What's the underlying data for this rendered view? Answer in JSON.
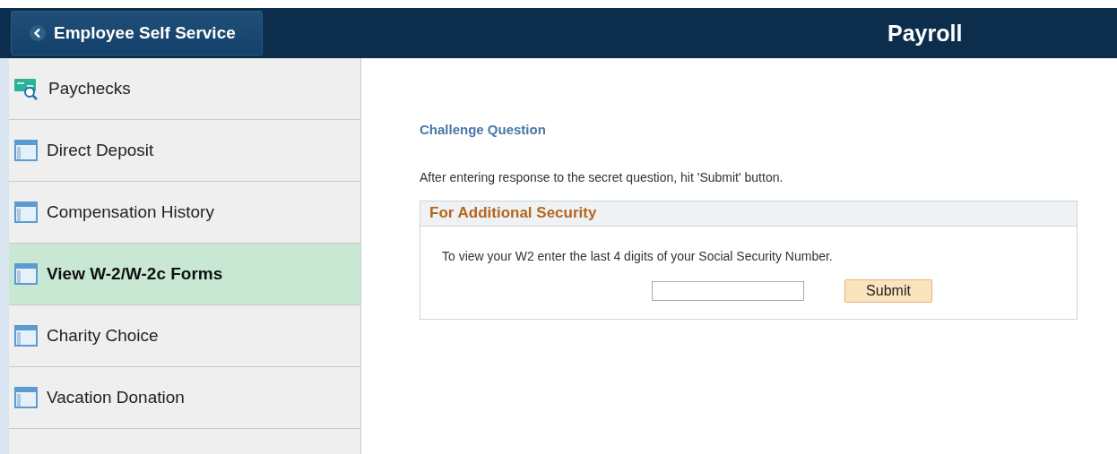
{
  "header": {
    "back_button": "Employee Self Service",
    "title": "Payroll"
  },
  "sidebar": {
    "items": [
      {
        "label": "Paychecks",
        "kind": "paycheck",
        "selected": false
      },
      {
        "label": "Direct Deposit",
        "kind": "page",
        "selected": false
      },
      {
        "label": "Compensation History",
        "kind": "page",
        "selected": false
      },
      {
        "label": "View W-2/W-2c Forms",
        "kind": "page",
        "selected": true
      },
      {
        "label": "Charity Choice",
        "kind": "page",
        "selected": false
      },
      {
        "label": "Vacation Donation",
        "kind": "page",
        "selected": false
      }
    ]
  },
  "content": {
    "heading": "Challenge Question",
    "instruction": "After entering response to the secret question, hit 'Submit' button.",
    "panel": {
      "title": "For Additional Security",
      "prompt": "To view your W2 enter the last 4 digits of your Social Security Number.",
      "submit": "Submit"
    }
  }
}
